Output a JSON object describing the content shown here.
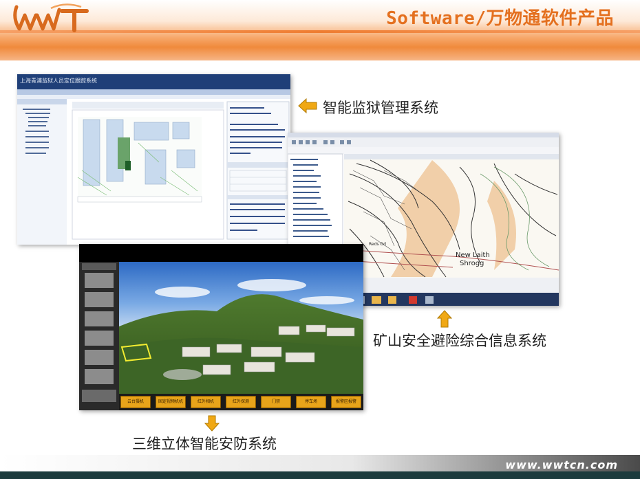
{
  "header": {
    "title": "Software/万物通软件产品",
    "logo_text": "WWT"
  },
  "products": [
    {
      "label": "智能监狱管理系统",
      "screen_title": "上海青浦监狱人员定位跟踪系统"
    },
    {
      "label": "矿山安全避险综合信息系统",
      "map_text": [
        "New Laith",
        "Shrogg",
        "Reds Gd"
      ]
    },
    {
      "label": "三维立体智能安防系统",
      "buttons": [
        "云台摄机",
        "固定视频机机",
        "红外相机",
        "红外探测",
        "门禁",
        "停车场",
        "报警区报警"
      ]
    }
  ],
  "footer": {
    "url": "www.wwtcn.com"
  },
  "colors": {
    "accent": "#e4701f",
    "arrow": "#f0a814",
    "footer_dark": "#1c3b3d"
  }
}
